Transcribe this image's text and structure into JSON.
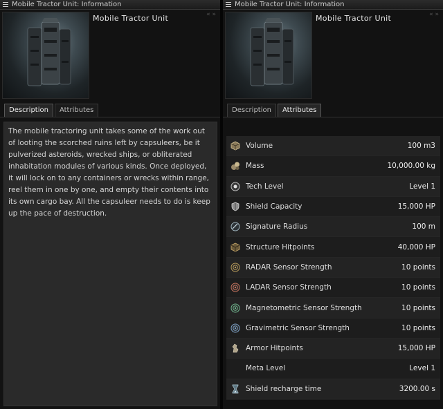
{
  "windows": [
    {
      "title": "Mobile Tractor Unit: Information",
      "item_name": "Mobile Tractor Unit",
      "collapse_glyph": "« »",
      "tabs": [
        {
          "label": "Description",
          "active": true
        },
        {
          "label": "Attributes",
          "active": false
        }
      ]
    },
    {
      "title": "Mobile Tractor Unit: Information",
      "item_name": "Mobile Tractor Unit",
      "collapse_glyph": "« »",
      "tabs": [
        {
          "label": "Description",
          "active": false
        },
        {
          "label": "Attributes",
          "active": true
        }
      ]
    }
  ],
  "description": "The mobile tractoring unit takes some of the work out of looting the scorched ruins left by capsuleers, be it pulverized asteroids, wrecked ships, or obliterated inhabitation modules of various kinds. Once deployed, it will lock on to any containers or wrecks within range, reel them in one by one, and empty their contents into its own cargo bay. All the capsuleer needs to do is keep up the pace of destruction.",
  "attributes": [
    {
      "label": "Volume",
      "value": "100 m3",
      "icon": "cube-icon"
    },
    {
      "label": "Mass",
      "value": "10,000.00 kg",
      "icon": "mass-rocks-icon"
    },
    {
      "label": "Tech Level",
      "value": "Level 1",
      "icon": "tech-level-icon"
    },
    {
      "label": "Shield Capacity",
      "value": "15,000 HP",
      "icon": "shield-icon"
    },
    {
      "label": "Signature Radius",
      "value": "100 m",
      "icon": "signature-radius-icon"
    },
    {
      "label": "Structure Hitpoints",
      "value": "40,000 HP",
      "icon": "structure-icon"
    },
    {
      "label": "RADAR Sensor Strength",
      "value": "10 points",
      "icon": "radar-sensor-icon"
    },
    {
      "label": "LADAR Sensor Strength",
      "value": "10 points",
      "icon": "ladar-sensor-icon"
    },
    {
      "label": "Magnetometric Sensor Strength",
      "value": "10 points",
      "icon": "magnetometric-sensor-icon"
    },
    {
      "label": "Gravimetric Sensor Strength",
      "value": "10 points",
      "icon": "gravimetric-sensor-icon"
    },
    {
      "label": "Armor Hitpoints",
      "value": "15,000 HP",
      "icon": "armor-icon"
    },
    {
      "label": "Meta Level",
      "value": "Level 1",
      "icon": ""
    },
    {
      "label": "Shield recharge time",
      "value": "3200.00 s",
      "icon": "hourglass-icon"
    }
  ],
  "colors": {
    "radar": "#b89a58",
    "ladar": "#c4705a",
    "magnetometric": "#6fb58d",
    "gravimetric": "#7a9fc4"
  }
}
